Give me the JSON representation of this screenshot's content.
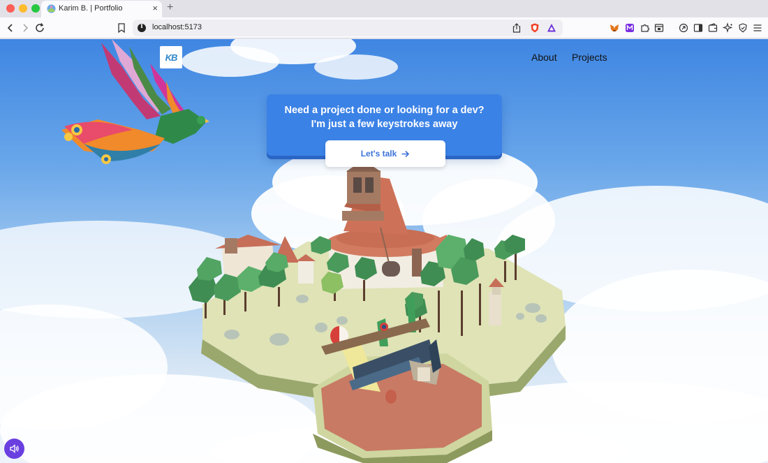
{
  "browser": {
    "tab_title": "Karim B. | Portfolio",
    "tab_close": "×",
    "new_tab": "+",
    "url": "localhost:5173"
  },
  "site": {
    "logo_text": "KB",
    "nav": [
      {
        "label": "About"
      },
      {
        "label": "Projects"
      }
    ],
    "hero": {
      "line1": "Need a project done or looking for a dev?",
      "line2": "I'm just a few keystrokes away",
      "cta_label": "Let's talk"
    }
  },
  "colors": {
    "accent": "#3b82e6",
    "cta_text": "#3b72d9",
    "sound_button": "#6a3fe0"
  },
  "icons": {
    "back": "chevron-left-icon",
    "forward": "chevron-right-icon",
    "reload": "reload-icon",
    "bookmark": "bookmark-icon",
    "share": "share-icon",
    "brave": "brave-shield-icon",
    "rewards": "brave-rewards-icon",
    "metamask": "metamask-icon",
    "extension": "puzzle-icon",
    "menu": "hamburger-icon",
    "sound": "speaker-icon",
    "cta_arrow": "arrow-right-icon"
  }
}
